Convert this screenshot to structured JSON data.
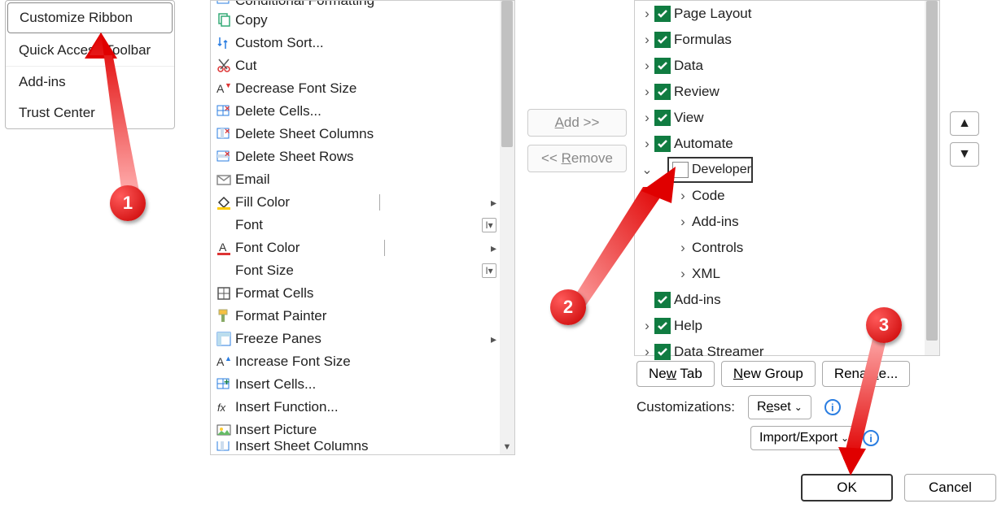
{
  "sidebar": {
    "items": [
      {
        "id": "customize-ribbon",
        "label": "Customize Ribbon",
        "selected": true
      },
      {
        "id": "quick-access-toolbar",
        "label": "Quick Access Toolbar",
        "selected": false
      },
      {
        "id": "add-ins",
        "label": "Add-ins",
        "selected": false
      },
      {
        "id": "trust-center",
        "label": "Trust Center",
        "selected": false
      }
    ]
  },
  "commands": [
    {
      "icon": "conditional-formatting-icon",
      "label": "Conditional Formatting",
      "partial": true
    },
    {
      "icon": "copy-icon",
      "label": "Copy"
    },
    {
      "icon": "custom-sort-icon",
      "label": "Custom Sort..."
    },
    {
      "icon": "cut-icon",
      "label": "Cut"
    },
    {
      "icon": "decrease-font-icon",
      "label": "Decrease Font Size"
    },
    {
      "icon": "delete-cells-icon",
      "label": "Delete Cells..."
    },
    {
      "icon": "delete-sheet-columns-icon",
      "label": "Delete Sheet Columns"
    },
    {
      "icon": "delete-sheet-rows-icon",
      "label": "Delete Sheet Rows"
    },
    {
      "icon": "email-icon",
      "label": "Email"
    },
    {
      "icon": "fill-color-icon",
      "label": "Fill Color",
      "flyout": "right",
      "splitter": true
    },
    {
      "icon": "font-icon",
      "label": "Font",
      "flyout": "box",
      "indent": true
    },
    {
      "icon": "font-color-icon",
      "label": "Font Color",
      "flyout": "right",
      "splitter": true
    },
    {
      "icon": "font-size-icon",
      "label": "Font Size",
      "flyout": "box",
      "indent": true
    },
    {
      "icon": "format-cells-icon",
      "label": "Format Cells"
    },
    {
      "icon": "format-painter-icon",
      "label": "Format Painter"
    },
    {
      "icon": "freeze-panes-icon",
      "label": "Freeze Panes",
      "flyout": "right"
    },
    {
      "icon": "increase-font-icon",
      "label": "Increase Font Size"
    },
    {
      "icon": "insert-cells-icon",
      "label": "Insert Cells..."
    },
    {
      "icon": "insert-function-icon",
      "label": "Insert Function..."
    },
    {
      "icon": "insert-picture-icon",
      "label": "Insert Picture"
    },
    {
      "icon": "insert-sheet-columns-icon",
      "label": "Insert Sheet Columns",
      "partial_bottom": true
    }
  ],
  "mid": {
    "add": "Add >>",
    "add_u": "A",
    "remove": "<< Remove",
    "remove_u": "R"
  },
  "tree": [
    {
      "label": "Page Layout",
      "checked": true,
      "expand": "right"
    },
    {
      "label": "Formulas",
      "checked": true,
      "expand": "right"
    },
    {
      "label": "Data",
      "checked": true,
      "expand": "right"
    },
    {
      "label": "Review",
      "checked": true,
      "expand": "right"
    },
    {
      "label": "View",
      "checked": true,
      "expand": "right"
    },
    {
      "label": "Automate",
      "checked": true,
      "expand": "right"
    },
    {
      "label": "Developer",
      "checked": false,
      "expand": "down",
      "selected": true,
      "children": [
        {
          "label": "Code"
        },
        {
          "label": "Add-ins"
        },
        {
          "label": "Controls"
        },
        {
          "label": "XML"
        }
      ]
    },
    {
      "label": "Add-ins",
      "checked": true,
      "expand": "none"
    },
    {
      "label": "Help",
      "checked": true,
      "expand": "right"
    },
    {
      "label": "Data Streamer",
      "checked": true,
      "expand": "right"
    }
  ],
  "buttons": {
    "new_tab": "New Tab",
    "new_tab_u": "w",
    "new_group": "New Group",
    "new_group_u": "N",
    "rename": "Rename...",
    "rename_u": "m",
    "customizations": "Customizations:",
    "reset": "Reset",
    "reset_u": "e",
    "import_export": "Import/Export",
    "ok": "OK",
    "cancel": "Cancel"
  },
  "annotations": {
    "b1": "1",
    "b2": "2",
    "b3": "3"
  }
}
